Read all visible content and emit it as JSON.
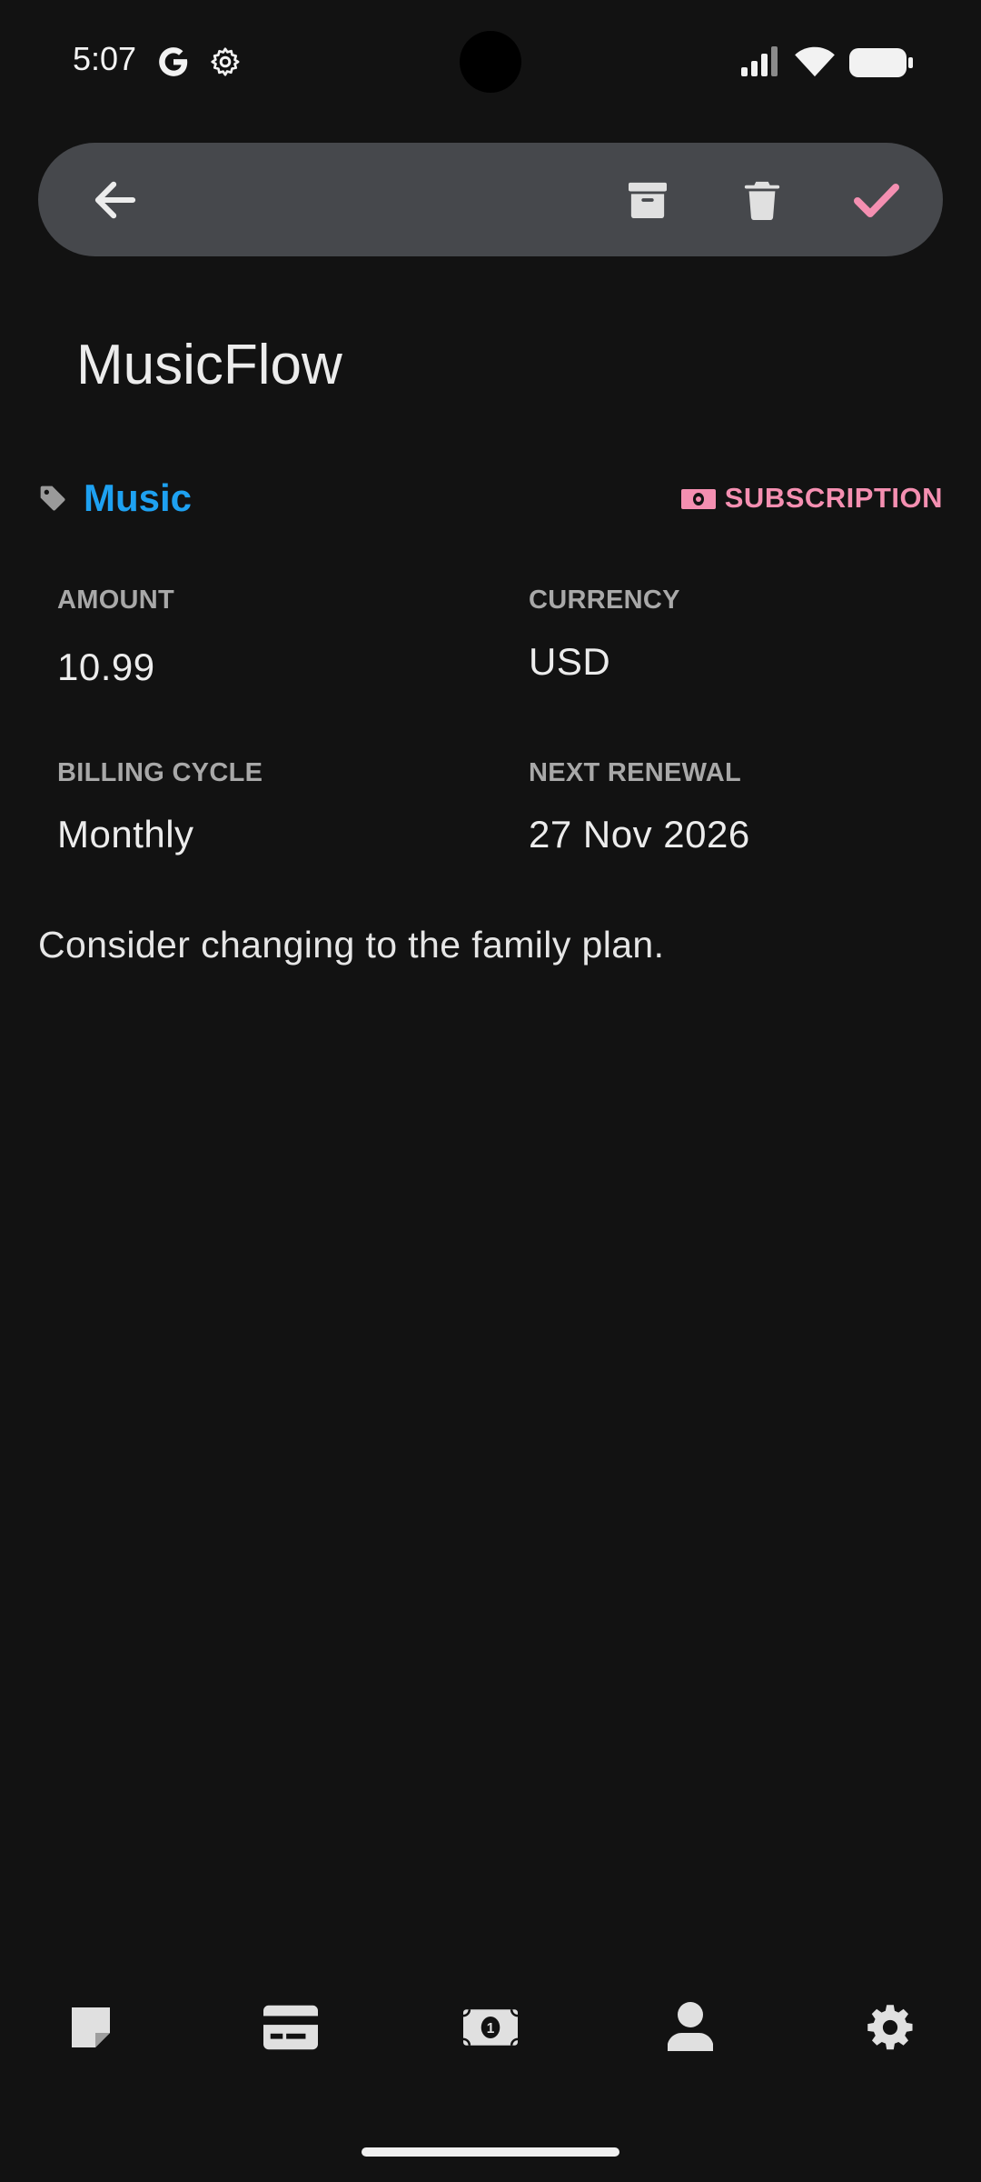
{
  "status_bar": {
    "time": "5:07",
    "icons": [
      "google-icon",
      "settings-gear-icon",
      "signal-icon",
      "wifi-icon",
      "battery-icon"
    ]
  },
  "toolbar": {
    "icons": [
      "back-arrow-icon",
      "archive-icon",
      "delete-icon",
      "check-icon"
    ],
    "accent": "#f48fb1",
    "background": "#46484c"
  },
  "subscription": {
    "name": "MusicFlow",
    "category": "Music",
    "type": "SUBSCRIPTION",
    "fields": {
      "amount_label": "AMOUNT",
      "amount_value": "10.99",
      "currency_label": "CURRENCY",
      "currency_value": "USD",
      "billing_label": "BILLING CYCLE",
      "billing_value": "Monthly",
      "renewal_label": "NEXT RENEWAL",
      "renewal_value": "27 Nov 2026"
    },
    "note": "Consider changing to the family plan."
  },
  "colors": {
    "background": "#121212",
    "category": "#1ea1f1",
    "type": "#f48fb1"
  },
  "bottom_nav": {
    "icons": [
      "notes-icon",
      "credit-card-icon",
      "money-bill-icon",
      "person-icon",
      "settings-icon"
    ]
  }
}
